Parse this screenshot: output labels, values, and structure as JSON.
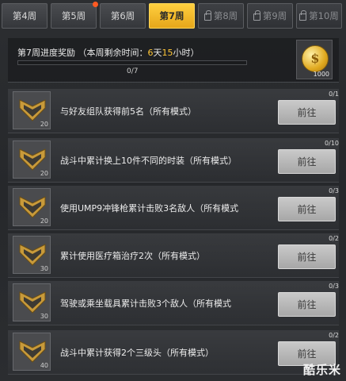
{
  "tabs": [
    {
      "label": "第4周",
      "state": "normal"
    },
    {
      "label": "第5周",
      "state": "normal",
      "notification": true
    },
    {
      "label": "第6周",
      "state": "normal"
    },
    {
      "label": "第7周",
      "state": "active"
    },
    {
      "label": "第8周",
      "state": "locked"
    },
    {
      "label": "第9周",
      "state": "locked"
    },
    {
      "label": "第10周",
      "state": "locked"
    }
  ],
  "progress": {
    "title_prefix": "第7周进度奖励 （本周剩余时间：",
    "days": "6",
    "days_unit": "天",
    "hours": "15",
    "hours_unit": "小时）",
    "count": "0/7",
    "fraction": 0,
    "reward_amount": "1000"
  },
  "tasks": [
    {
      "desc": "与好友组队获得前5名（所有模式）",
      "count": "0/1",
      "points": "20",
      "button": "前往"
    },
    {
      "desc": "战斗中累计换上10件不同的时装（所有模式）",
      "count": "0/10",
      "points": "20",
      "button": "前往"
    },
    {
      "desc": "使用UMP9冲锋枪累计击败3名敌人（所有模式",
      "count": "0/3",
      "points": "20",
      "button": "前往"
    },
    {
      "desc": "累计使用医疗箱治疗2次（所有模式）",
      "count": "0/2",
      "points": "30",
      "button": "前往"
    },
    {
      "desc": "驾驶或乘坐载具累计击败3个敌人（所有模式",
      "count": "0/3",
      "points": "30",
      "button": "前往"
    },
    {
      "desc": "战斗中累计获得2个三级头（所有模式）",
      "count": "0/2",
      "points": "40",
      "button": "前往"
    }
  ],
  "watermark": "酷乐米",
  "colors": {
    "accent": "#ffc636",
    "button": "#b8b8b8"
  }
}
